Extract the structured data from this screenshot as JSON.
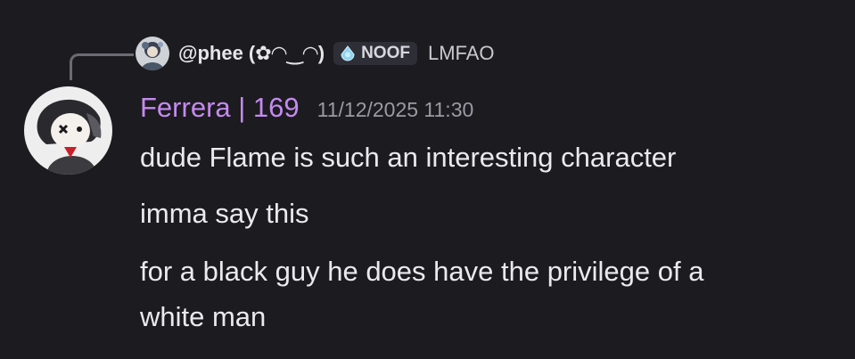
{
  "reply": {
    "author": "@phee (✿◠‿◠)",
    "tag": {
      "text": "NOOF",
      "icon": "droplet-icon"
    },
    "content": "LMFAO"
  },
  "message": {
    "author": "Ferrera | 169",
    "author_color": "#c58af0",
    "timestamp": "11/12/2025 11:30",
    "lines": [
      "dude Flame is such an interesting character",
      "imma say this",
      "for a black guy he does have the privilege of a",
      "white man"
    ]
  },
  "colors": {
    "background": "#1c1b20",
    "text": "#e9e9ee",
    "muted": "#9a9aa3"
  }
}
